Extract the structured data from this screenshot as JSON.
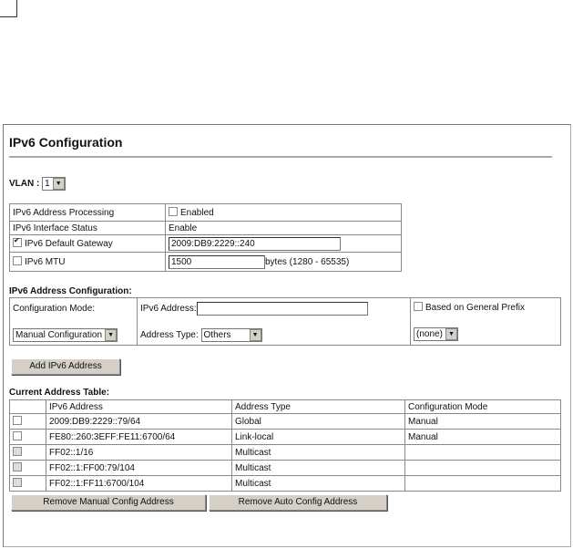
{
  "title": "IPv6 Configuration",
  "vlan": {
    "label": "VLAN :",
    "value": "1"
  },
  "settings": {
    "processing": {
      "label": "IPv6 Address Processing",
      "checkbox_label": "Enabled",
      "checked": false
    },
    "status": {
      "label": "IPv6 Interface Status",
      "value": "Enable"
    },
    "gateway": {
      "label": "IPv6 Default Gateway",
      "checked": true,
      "value": "2009:DB9:2229::240"
    },
    "mtu": {
      "label": "IPv6 MTU",
      "checked": false,
      "value": "1500",
      "hint": "bytes (1280 - 65535)"
    }
  },
  "addr_config": {
    "heading": "IPv6 Address Configuration:",
    "mode_label": "Configuration Mode:",
    "mode_value": "Manual Configuration",
    "address_label": "IPv6 Address:",
    "address_value": "",
    "type_label": "Address Type:",
    "type_value": "Others",
    "prefix_label": "Based on General Prefix",
    "prefix_value": "(none)",
    "add_button": "Add IPv6 Address"
  },
  "address_table": {
    "heading": "Current Address Table:",
    "columns": [
      "IPv6 Address",
      "Address Type",
      "Configuration Mode"
    ],
    "rows": [
      {
        "address": "2009:DB9:2229::79/64",
        "type": "Global",
        "mode": "Manual"
      },
      {
        "address": "FE80::260:3EFF:FE11:6700/64",
        "type": "Link-local",
        "mode": "Manual"
      },
      {
        "address": "FF02::1/16",
        "type": "Multicast",
        "mode": ""
      },
      {
        "address": "FF02::1:FF00:79/104",
        "type": "Multicast",
        "mode": ""
      },
      {
        "address": "FF02::1:FF11:6700/104",
        "type": "Multicast",
        "mode": ""
      }
    ],
    "remove_manual": "Remove Manual Config Address",
    "remove_auto": "Remove Auto Config Address"
  }
}
